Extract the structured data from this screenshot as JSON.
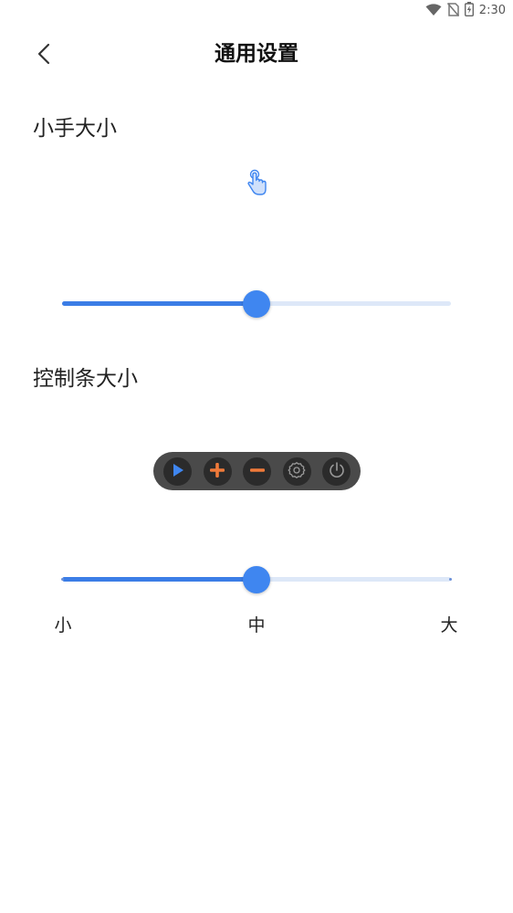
{
  "status_bar": {
    "time": "2:30",
    "icons": [
      "wifi-icon",
      "no-sim-icon",
      "battery-charging-icon"
    ]
  },
  "header": {
    "title": "通用设置",
    "back_icon": "chevron-left-icon"
  },
  "hand_size": {
    "title": "小手大小",
    "preview_icon": "pointing-hand-icon",
    "slider_value_fraction": 0.5
  },
  "control_bar_size": {
    "title": "控制条大小",
    "buttons": [
      "play-icon",
      "plus-icon",
      "minus-icon",
      "gear-icon",
      "power-icon"
    ],
    "slider_value_fraction": 0.5,
    "scale_labels": {
      "small": "小",
      "medium": "中",
      "large": "大"
    }
  },
  "colors": {
    "accent": "#3f86f0",
    "track": "#dde8f8",
    "control_bar_bg": "#4a4a4a",
    "play": "#3f86f0",
    "plus": "#f07a3a",
    "minus": "#f07a3a"
  }
}
